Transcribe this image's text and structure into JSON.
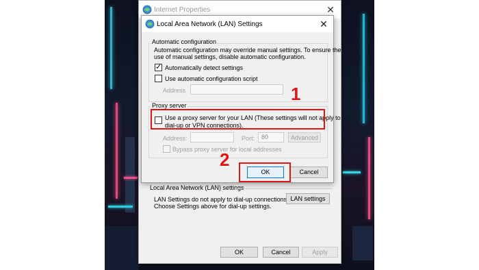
{
  "outer_window": {
    "title": "Internet Properties",
    "close": "✕",
    "lan_section": {
      "title": "Local Area Network (LAN) settings",
      "description_line1": "LAN Settings do not apply to dial-up connections.",
      "description_line2": "Choose Settings above for dial-up settings.",
      "button": "LAN settings"
    },
    "buttons": {
      "ok": "OK",
      "cancel": "Cancel",
      "apply": "Apply"
    }
  },
  "dialog": {
    "title": "Local Area Network (LAN) Settings",
    "close": "✕",
    "automatic_configuration": {
      "label": "Automatic configuration",
      "description_line1": "Automatic configuration may override manual settings.  To ensure the",
      "description_line2": "use of manual settings, disable automatic configuration.",
      "detect_label": "Automatically detect settings",
      "detect_checked": true,
      "script_label": "Use automatic configuration script",
      "script_checked": false,
      "address_label": "Address",
      "address_value": ""
    },
    "proxy_server": {
      "label": "Proxy server",
      "use_proxy_line1": "Use a proxy server for your LAN (These settings will not apply to",
      "use_proxy_line2": "dial-up or VPN connections).",
      "use_proxy_checked": false,
      "address_label": "Address:",
      "address_value": "",
      "port_label": "Port:",
      "port_value": "80",
      "advanced_button": "Advanced",
      "bypass_label": "Bypass proxy server for local addresses",
      "bypass_checked": false
    },
    "buttons": {
      "ok": "OK",
      "cancel": "Cancel"
    }
  },
  "annotations": {
    "step1": "1",
    "step2": "2"
  },
  "colors": {
    "annotation_red": "#e01515",
    "focus_blue": "#0078d7"
  }
}
